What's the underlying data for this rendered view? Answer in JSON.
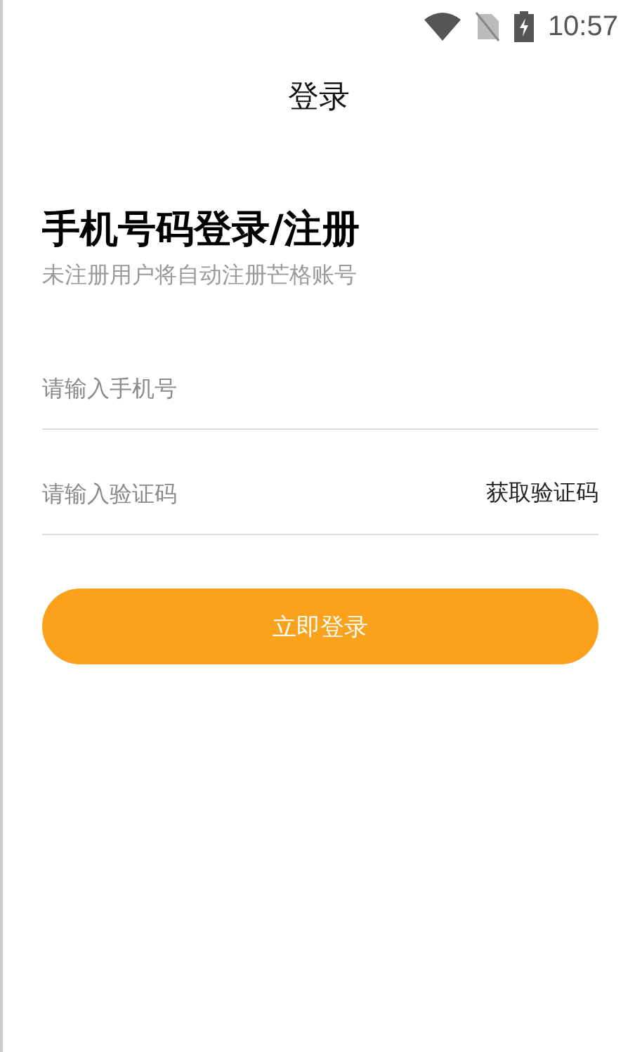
{
  "status_bar": {
    "time": "10:57"
  },
  "header": {
    "title": "登录"
  },
  "heading": "手机号码登录/注册",
  "subtitle": "未注册用户将自动注册芒格账号",
  "phone_field": {
    "placeholder": "请输入手机号"
  },
  "code_field": {
    "placeholder": "请输入验证码",
    "action": "获取验证码"
  },
  "login_button": "立即登录"
}
